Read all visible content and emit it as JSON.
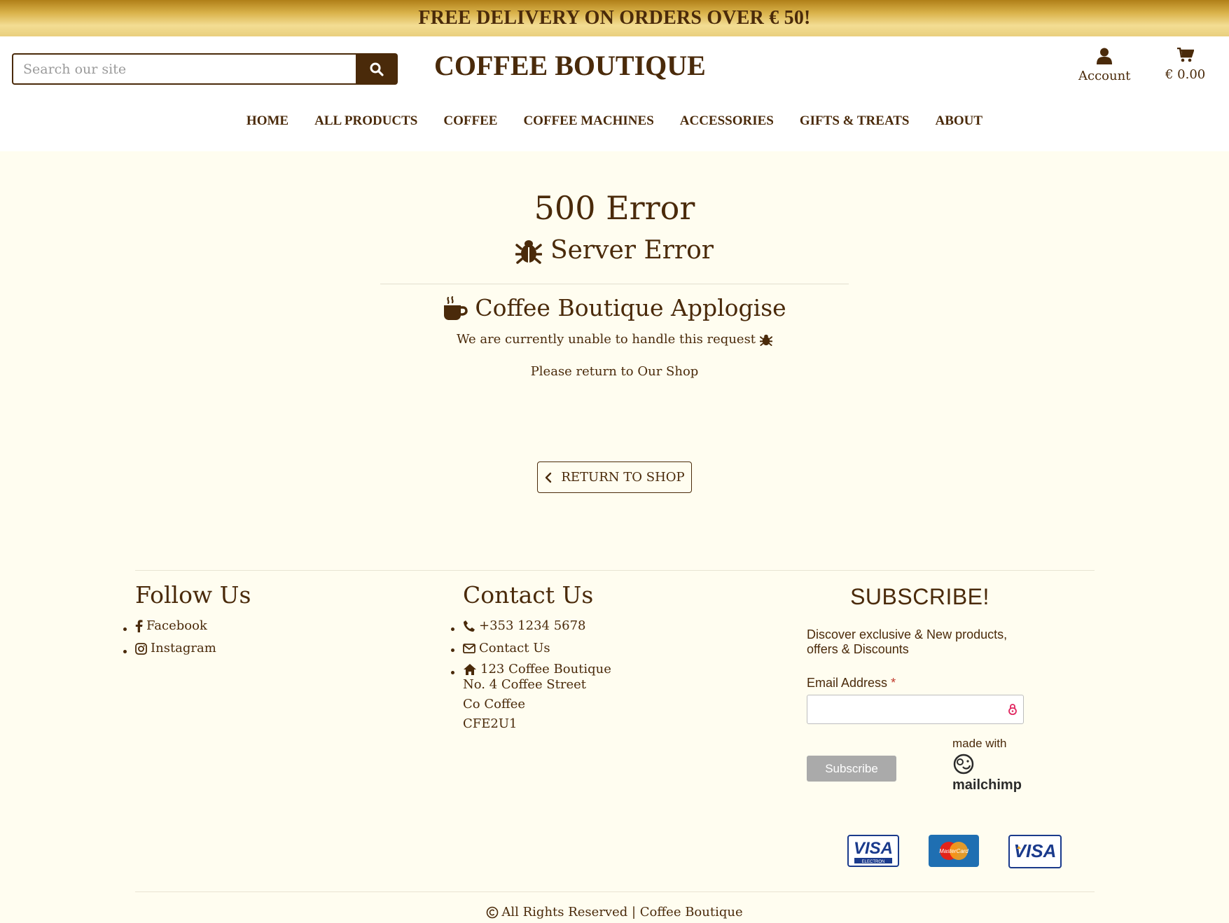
{
  "banner": {
    "text": "FREE DELIVERY ON ORDERS OVER € 50!"
  },
  "header": {
    "search_placeholder": "Search our site",
    "brand": "COFFEE BOUTIQUE",
    "account_label": "Account",
    "cart_total": "€ 0.00"
  },
  "nav": {
    "items": [
      "HOME",
      "ALL PRODUCTS",
      "COFFEE",
      "COFFEE MACHINES",
      "ACCESSORIES",
      "GIFTS & TREATS",
      "ABOUT"
    ]
  },
  "error": {
    "title": "500 Error",
    "subtitle": "Server Error",
    "apology": "Coffee Boutique Applogise",
    "message": "We are currently unable to handle this request",
    "return_note": "Please return to Our Shop",
    "return_button": "RETURN TO SHOP"
  },
  "footer": {
    "follow": {
      "title": "Follow Us",
      "links": [
        {
          "label": "Facebook",
          "icon": "facebook-icon"
        },
        {
          "label": "Instagram",
          "icon": "instagram-icon"
        }
      ]
    },
    "contact": {
      "title": "Contact Us",
      "phone": "+353 1234 5678",
      "contact_link": "Contact Us",
      "address_name": "123 Coffee Boutique",
      "address_lines": [
        "No. 4 Coffee Street",
        "Co Coffee",
        "CFE2U1"
      ]
    },
    "subscribe": {
      "title": "SUBSCRIBE!",
      "text": "Discover exclusive & New products, offers & Discounts",
      "email_label": "Email Address",
      "required_mark": "*",
      "button": "Subscribe",
      "made_with": "made with",
      "mailchimp": "mailchimp"
    },
    "cards": [
      {
        "name": "visa-electron",
        "word": "VISA",
        "sub": "ELECTRON"
      },
      {
        "name": "mastercard",
        "word": "MasterCard"
      },
      {
        "name": "visa",
        "word": "VISA"
      }
    ],
    "copyright": "All Rights Reserved | Coffee Boutique"
  },
  "colors": {
    "brand_brown": "#4a2a0a",
    "page_bg": "#fffdf0",
    "banner_gold": "#d9b24a"
  }
}
